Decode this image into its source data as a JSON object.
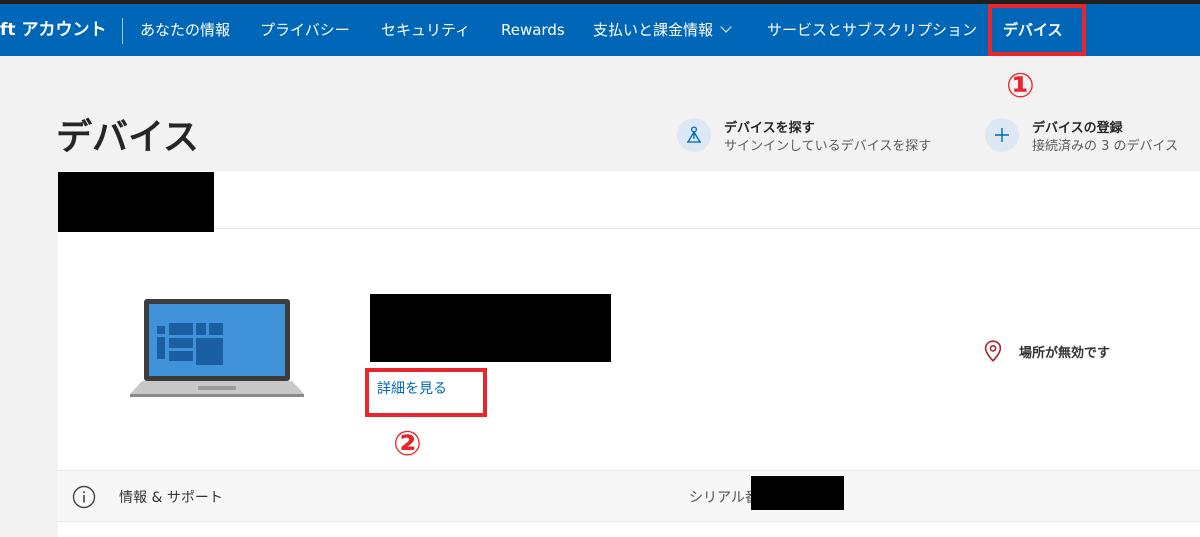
{
  "header": {
    "brand": "ft アカウント",
    "nav": [
      {
        "label": "あなたの情報"
      },
      {
        "label": "プライバシー"
      },
      {
        "label": "セキュリティ"
      },
      {
        "label": "Rewards"
      },
      {
        "label": "支払いと課金情報",
        "has_dropdown": true
      },
      {
        "label": "サービスとサブスクリプション"
      },
      {
        "label": "デバイス",
        "active": true
      }
    ]
  },
  "annotations": {
    "step1": "①",
    "step2": "②",
    "box_color": "#e8262d"
  },
  "page": {
    "title": "デバイス"
  },
  "actions": {
    "find": {
      "title": "デバイスを探す",
      "subtitle": "サインインしているデバイスを探す",
      "icon": "find-device-icon"
    },
    "register": {
      "title": "デバイスの登録",
      "subtitle": "接続済みの 3 のデバイス",
      "icon": "plus-icon"
    }
  },
  "device": {
    "details_link": "詳細を見る",
    "location_status": "場所が無効です",
    "info_label": "情報 & サポート",
    "serial_label": "シリアル番号"
  },
  "colors": {
    "accent": "#0067b8",
    "annotation_red": "#e8262d",
    "location_icon": "#a4262c"
  }
}
